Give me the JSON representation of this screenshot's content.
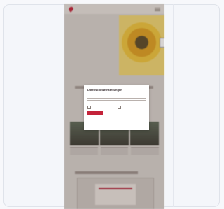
{
  "dialog": {
    "title": "Datenschutzeinstellungen",
    "accept_label": "",
    "decline_label": "",
    "option_1": "",
    "option_2": ""
  },
  "hero": {
    "headline": "",
    "subline": ""
  },
  "colors": {
    "brand_red": "#c4233a",
    "page_bg": "#d9d4cf",
    "card_bg": "#f4f6fa"
  }
}
